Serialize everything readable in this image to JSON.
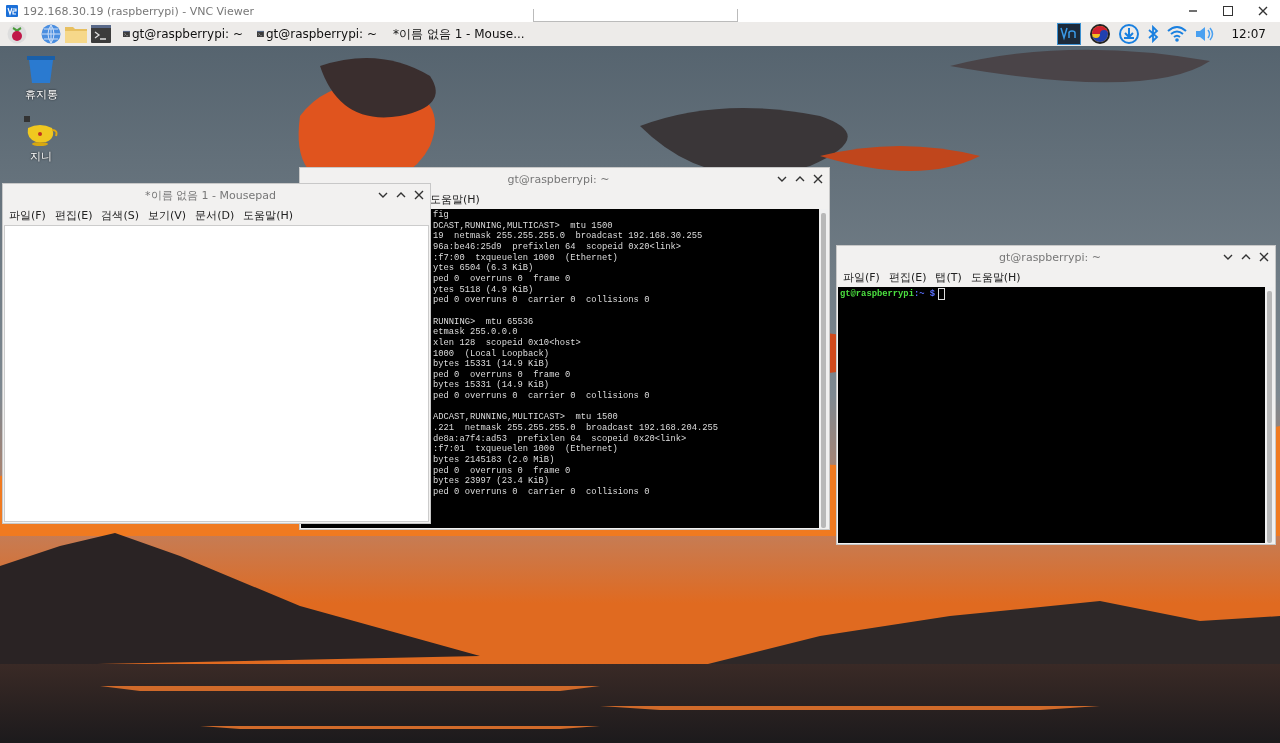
{
  "vnc_window": {
    "title": "192.168.30.19 (raspberrypi) - VNC Viewer"
  },
  "taskbar": {
    "tasks": [
      {
        "kind": "terminal",
        "label": "gt@raspberrypi: ~"
      },
      {
        "kind": "terminal",
        "label": "gt@raspberrypi: ~"
      },
      {
        "kind": "editor",
        "label": "*이름 없음 1 - Mouse..."
      }
    ],
    "clock": "12:07"
  },
  "desktop_icons": [
    {
      "kind": "trash",
      "label": "휴지통"
    },
    {
      "kind": "genie",
      "label": "지니"
    }
  ],
  "windows": [
    {
      "kind": "terminal",
      "title": "gt@raspberrypi: ~",
      "menu": [
        "도움말(H)"
      ],
      "output_blocks": [
        [
          "fig",
          "DCAST,RUNNING,MULTICAST>  mtu 1500",
          "19  netmask 255.255.255.0  broadcast 192.168.30.255",
          "96a:be46:25d9  prefixlen 64  scopeid 0x20<link>",
          ":f7:00  txqueuelen 1000  (Ethernet)",
          "ytes 6504 (6.3 KiB)",
          "ped 0  overruns 0  frame 0",
          "ytes 5118 (4.9 KiB)",
          "ped 0 overruns 0  carrier 0  collisions 0"
        ],
        [
          "RUNNING>  mtu 65536",
          "etmask 255.0.0.0",
          "xlen 128  scopeid 0x10<host>",
          "1000  (Local Loopback)",
          "bytes 15331 (14.9 KiB)",
          "ped 0  overruns 0  frame 0",
          "bytes 15331 (14.9 KiB)",
          "ped 0 overruns 0  carrier 0  collisions 0"
        ],
        [
          "ADCAST,RUNNING,MULTICAST>  mtu 1500",
          ".221  netmask 255.255.255.0  broadcast 192.168.204.255",
          "de8a:a7f4:ad53  prefixlen 64  scopeid 0x20<link>",
          ":f7:01  txqueuelen 1000  (Ethernet)",
          "bytes 2145183 (2.0 MiB)",
          "ped 0  overruns 0  frame 0",
          "bytes 23997 (23.4 KiB)",
          "ped 0 overruns 0  carrier 0  collisions 0"
        ]
      ]
    },
    {
      "kind": "editor",
      "title": "*이름 없음 1 - Mousepad",
      "menu": [
        "파일(F)",
        "편집(E)",
        "검색(S)",
        "보기(V)",
        "문서(D)",
        "도움말(H)"
      ]
    },
    {
      "kind": "terminal",
      "title": "gt@raspberrypi: ~",
      "menu": [
        "파일(F)",
        "편집(E)",
        "탭(T)",
        "도움말(H)"
      ],
      "prompt": {
        "user_host": "gt@raspberrypi",
        "separator": ":",
        "path": "~",
        "symbol": "$"
      }
    }
  ]
}
